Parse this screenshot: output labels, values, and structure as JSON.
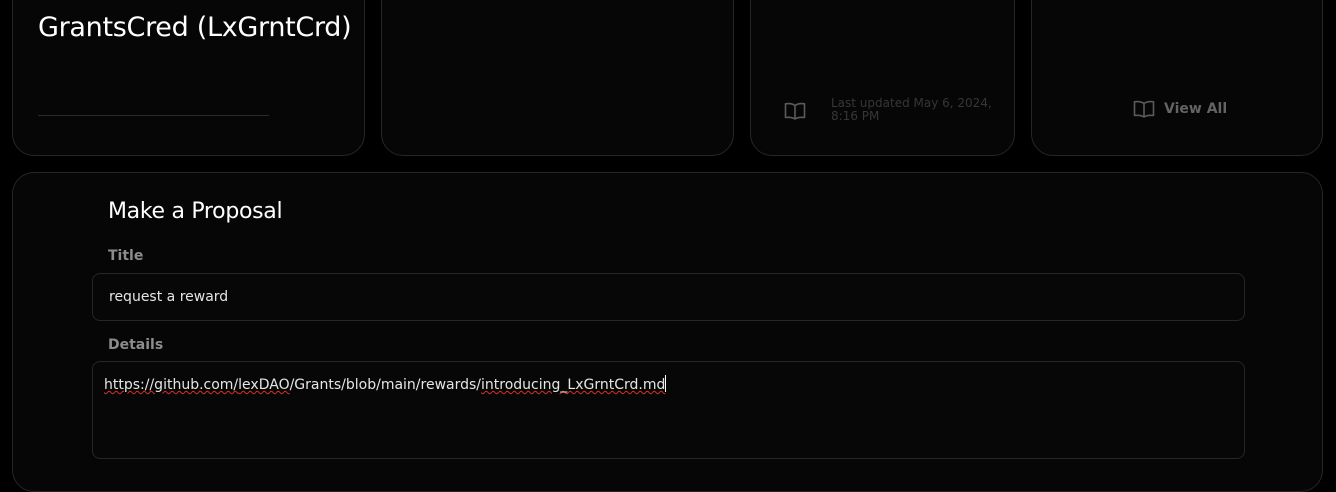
{
  "dao_card": {
    "name": "GrantsCred (LxGrntCrd)"
  },
  "docs_card": {
    "icon": "book-open-icon",
    "last_updated": "Last updated May 6, 2024, 8:16 PM"
  },
  "links_card": {
    "icon": "book-open-icon",
    "view_all_label": "View All"
  },
  "proposal_form": {
    "heading": "Make a Proposal",
    "title_label": "Title",
    "title_value": "request a reward",
    "details_label": "Details",
    "details_value": {
      "prefix": "https://github.com/",
      "word_1": "lexDAO",
      "middle": "/Grants/blob/main/rewards/",
      "word_2": "introducing_LxGrntCrd.md"
    }
  },
  "colors": {
    "background": "#000000",
    "card": "#060606",
    "border": "#262626",
    "muted_text": "#8c8c8c",
    "spellcheck": "#d93025"
  }
}
